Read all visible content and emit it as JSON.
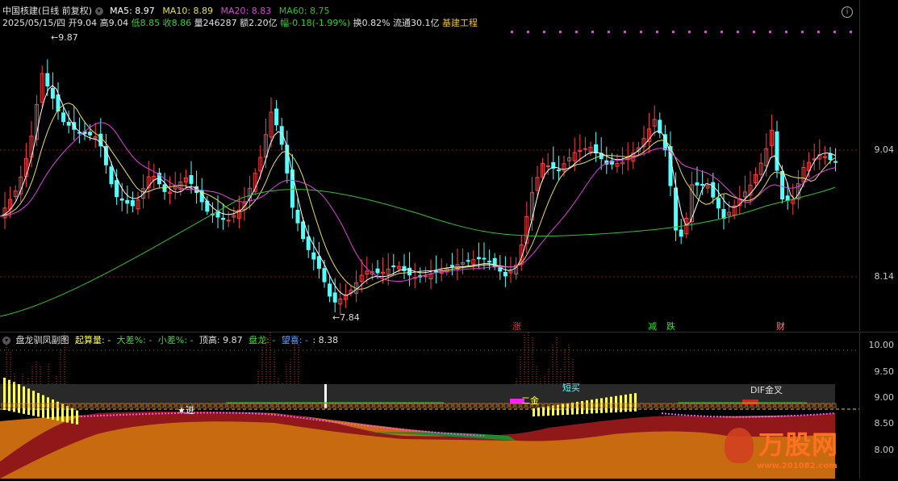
{
  "header": {
    "stock_title": "中国核建(日线 前复权)",
    "ma5_label": "MA5: 8.97",
    "ma10_label": "MA10: 8.89",
    "ma20_label": "MA20: 8.83",
    "ma60_label": "MA60: 8.75",
    "date": "2025/05/15/四",
    "open": "开9.04",
    "high": "高9.04",
    "low": "低8.85",
    "close": "收8.86",
    "volume": "量246287",
    "amount": "额2.20亿",
    "change": "幅-0.18(-1.99%)",
    "turnover": "换0.82%",
    "float_cap": "流通30.1亿",
    "sector": "基建工程"
  },
  "main_axis": {
    "ticks": [
      "9.04",
      "8.14"
    ]
  },
  "main_annotations": {
    "high_mark": "9.87",
    "low_mark": "7.84",
    "zhang": "涨",
    "jian": "减",
    "die": "跌",
    "cai": "财"
  },
  "sub_header": {
    "name": "盘龙驯凤副图",
    "qisuanliang": "起算量: -",
    "dacha": "大差%: -",
    "xiaocha": "小差%: -",
    "dinggao": "顶高: 9.87",
    "panlong": "盘龙: -",
    "wangxi": "望喜: -",
    "extra": ": 8.38"
  },
  "sub_axis": {
    "ticks": [
      "10.00",
      "9.50",
      "9.00",
      "8.50",
      "8.00"
    ]
  },
  "sub_annotations": {
    "duanmai": "短买",
    "erjin": "二金",
    "dif": "DIF金叉",
    "star": "★进"
  },
  "watermark": {
    "brand": "万股网",
    "url": "www.201082.com"
  },
  "colors": {
    "bg": "#000000",
    "up_candle": "#ff4040",
    "down_candle": "#54ffff",
    "ma5": "#ffffff",
    "ma10": "#e8e050",
    "ma20": "#e040e0",
    "ma60": "#30c030",
    "orange_area": "#c86a10",
    "red_area": "#901818",
    "grid": "#8a1414"
  }
}
